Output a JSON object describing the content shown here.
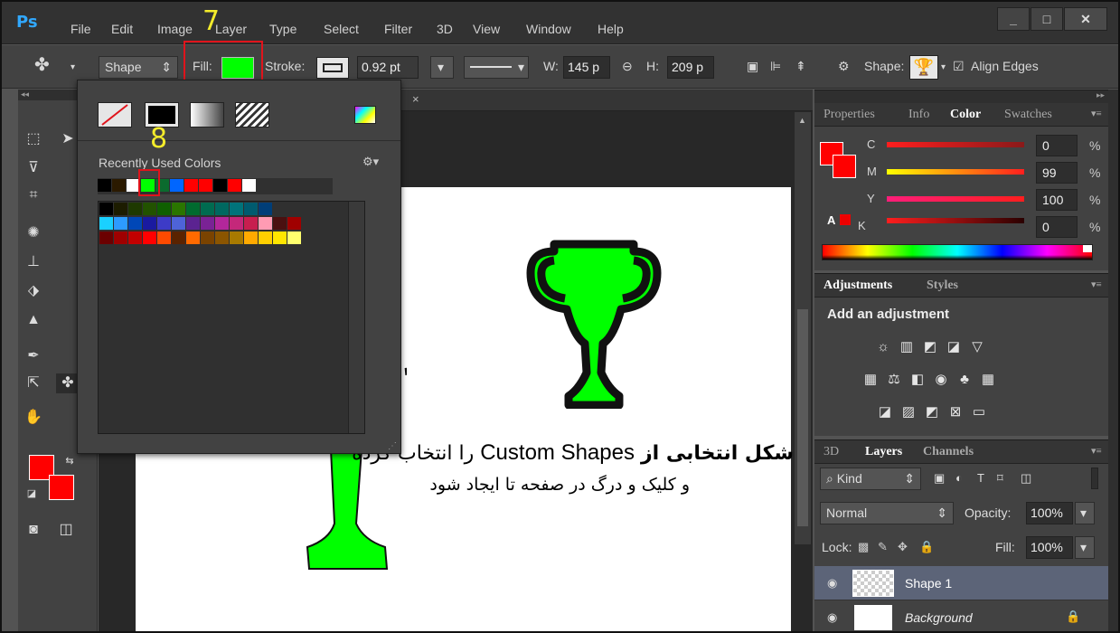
{
  "menubar": {
    "logo": "Ps",
    "items": [
      "File",
      "Edit",
      "Image",
      "Layer",
      "Type",
      "Select",
      "Filter",
      "3D",
      "View",
      "Window",
      "Help"
    ],
    "window_buttons": [
      "_",
      "□",
      "✕"
    ]
  },
  "options": {
    "mode": "Shape",
    "fill_label": "Fill:",
    "fill_color": "#00ff00",
    "stroke_label": "Stroke:",
    "stroke_width": "0.92 pt",
    "w_label": "W:",
    "w_value": "145 p",
    "h_label": "H:",
    "h_value": "209 p",
    "shape_label": "Shape:",
    "align_label": "Align Edges",
    "step7": "7"
  },
  "popup": {
    "step8": "8",
    "recent_label": "Recently Used Colors",
    "recent": [
      "#000000",
      "#2b1a00",
      "#ffffff",
      "#00ff00",
      "#0b6b2e",
      "#0066ff",
      "#ff0000",
      "#ff0000",
      "#000000",
      "#ff0000",
      "#ffffff"
    ],
    "swatches": [
      [
        "#000000",
        "#1c1c00",
        "#1e3900",
        "#225200",
        "#0f5f00",
        "#2a7500",
        "#006b2f",
        "#006b50",
        "#006860",
        "#00737a",
        "#005b6f",
        "#003e78"
      ],
      [
        "#1ad0ff",
        "#2d9bff",
        "#0047b7",
        "#1a1aa0",
        "#3d3bc7",
        "#4e63d8",
        "#5b2391",
        "#7a2295",
        "#b3279b",
        "#c4287a",
        "#c71e4f",
        "#ff9bb3",
        "#4a1010",
        "#a00000"
      ],
      [
        "#6b0000",
        "#a00000",
        "#c20000",
        "#ff0000",
        "#ff4a00",
        "#5a2300",
        "#ff6a00",
        "#7a4300",
        "#8b5500",
        "#a87a00",
        "#ffaa00",
        "#ffcf00",
        "#ffe600",
        "#ffff6e"
      ]
    ]
  },
  "document": {
    "tab_close": "×",
    "text_line1_bold": "شکل انتخابی از",
    "text_line1_latin": "Custom Shapes",
    "text_line1_end": "را انتخاب کرده",
    "text_line2": "و کلیک و درگ در صفحه تا ایجاد شود",
    "trophy_color": "#00ff00"
  },
  "color_panel": {
    "tabs": [
      "Properties",
      "Info",
      "Color",
      "Swatches"
    ],
    "active_tab": "Color",
    "channels": [
      {
        "label": "C",
        "value": "0",
        "unit": "%"
      },
      {
        "label": "M",
        "value": "99",
        "unit": "%"
      },
      {
        "label": "Y",
        "value": "100",
        "unit": "%"
      },
      {
        "label": "K",
        "value": "0",
        "unit": "%"
      }
    ]
  },
  "adjustments": {
    "tabs": [
      "Adjustments",
      "Styles"
    ],
    "heading": "Add an adjustment"
  },
  "layers": {
    "tabs": [
      "3D",
      "Layers",
      "Channels"
    ],
    "filter_kind": "Kind",
    "blend_mode": "Normal",
    "opacity_label": "Opacity:",
    "opacity_value": "100%",
    "lock_label": "Lock:",
    "fill_label": "Fill:",
    "fill_value": "100%",
    "rows": [
      {
        "name": "Shape 1"
      },
      {
        "name": "Background"
      }
    ]
  }
}
